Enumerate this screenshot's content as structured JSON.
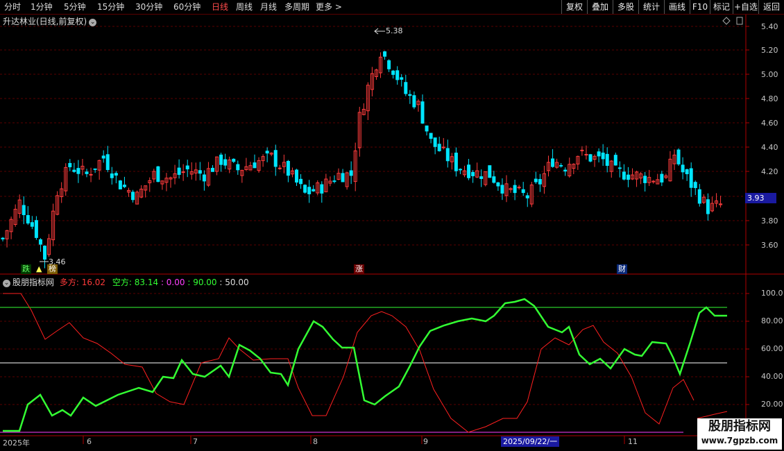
{
  "toolbar": {
    "timeframes": [
      "分时",
      "1分钟",
      "5分钟",
      "15分钟",
      "30分钟",
      "60分钟",
      "日线",
      "周线",
      "月线",
      "多周期",
      "更多 >"
    ],
    "active_index": 6,
    "buttons": [
      "复权",
      "叠加",
      "多股",
      "统计",
      "画线",
      "F10",
      "标记",
      "+自选",
      "返回"
    ]
  },
  "main_chart": {
    "title": "升达林业(日线,前复权)",
    "y_ticks": [
      "5.40",
      "5.20",
      "5.00",
      "4.80",
      "4.60",
      "4.40",
      "4.20",
      "3.80",
      "3.60"
    ],
    "current_price": "3.93",
    "high_label": "5.38",
    "low_label": "3.46",
    "markers": {
      "die": "跌",
      "bang": "榜",
      "zhang": "涨",
      "cai": "财"
    }
  },
  "indicator": {
    "name": "股朋指标网",
    "duo_label": "多方: 16.02",
    "kong_label": "空方: 83.14",
    "v0": ": 0.00",
    "v90": ": 90.00",
    "v50": ": 50.00",
    "y_ticks": [
      "100.0",
      "80.00",
      "60.00",
      "40.00",
      "20.00"
    ]
  },
  "x_axis": {
    "labels": [
      "2025年",
      "6",
      "7",
      "8",
      "9",
      "11"
    ],
    "cursor_date": "2025/09/22/一"
  },
  "watermark": {
    "line1": "股朋指标网",
    "line2": "www.7gpzb.com"
  },
  "colors": {
    "up": "#ff3c3c",
    "down": "#00e5ff",
    "duo": "#ff2020",
    "kong": "#33ff33",
    "line0": "#ff40ff",
    "line90": "#33ff33",
    "line50": "#ffffff"
  }
}
